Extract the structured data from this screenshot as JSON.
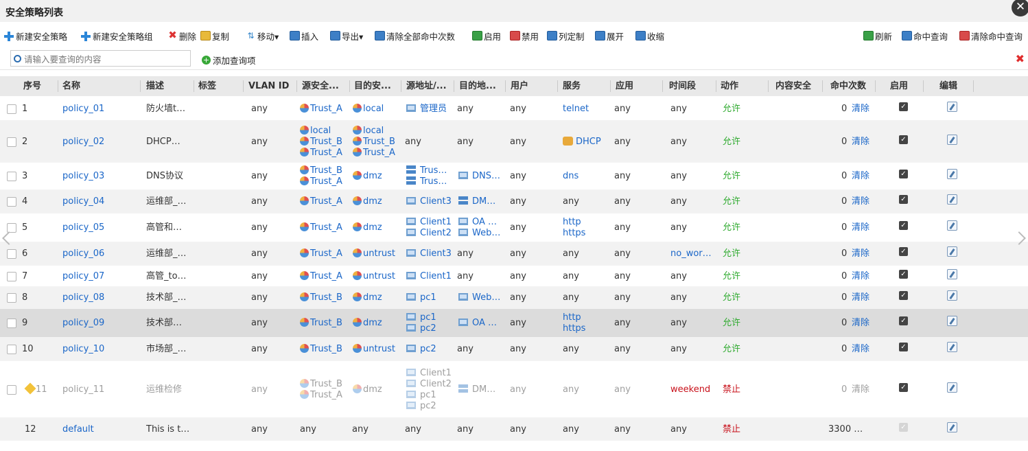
{
  "window": {
    "title": "安全策略列表",
    "close_glyph": "✕"
  },
  "toolbar": {
    "new_policy": "新建安全策略",
    "new_group": "新建安全策略组",
    "delete": "删除",
    "copy": "复制",
    "move": "移动▾",
    "insert": "插入",
    "export": "导出▾",
    "clear_hits": "清除全部命中次数",
    "enable": "启用",
    "disable": "禁用",
    "column_custom": "列定制",
    "expand": "展开",
    "collapse": "收缩",
    "refresh": "刷新",
    "hit_query": "命中查询",
    "clear_hit_query": "清除命中查询"
  },
  "search": {
    "placeholder": "请输入要查询的内容",
    "add_query": "添加查询项",
    "add_icon": "+"
  },
  "columns": {
    "seq": "序号",
    "name": "名称",
    "desc": "描述",
    "tag": "标签",
    "vlan": "VLAN ID",
    "src_zone": "源安全...",
    "dst_zone": "目的安...",
    "src_addr": "源地址/...",
    "dst_addr": "目的地...",
    "user": "用户",
    "service": "服务",
    "app": "应用",
    "time": "时间段",
    "action": "动作",
    "content": "内容安全",
    "hits": "命中次数",
    "enabled": "启用",
    "edit": "编辑"
  },
  "clear_label": "清除",
  "enabled_mark": "✓",
  "rows": [
    {
      "seq": "1",
      "name": "policy_01",
      "desc": "防火墙t…",
      "vlan": "any",
      "src_zone": [
        "Trust_A"
      ],
      "dst_zone": [
        "local"
      ],
      "src_addr": [
        "管理员"
      ],
      "dst_addr": [
        "any"
      ],
      "user": "any",
      "service": [
        "telnet"
      ],
      "app": "any",
      "time": "any",
      "action": "允许",
      "hits": "0"
    },
    {
      "seq": "2",
      "name": "policy_02",
      "desc": "DHCP…",
      "vlan": "any",
      "src_zone": [
        "local",
        "Trust_B",
        "Trust_A"
      ],
      "dst_zone": [
        "local",
        "Trust_B",
        "Trust_A"
      ],
      "src_addr": [
        "any"
      ],
      "dst_addr": [
        "any"
      ],
      "user": "any",
      "service": [
        "DHCP"
      ],
      "app": "any",
      "time": "any",
      "action": "允许",
      "hits": "0"
    },
    {
      "seq": "3",
      "name": "policy_03",
      "desc": "DNS协议",
      "vlan": "any",
      "src_zone": [
        "Trust_B",
        "Trust_A"
      ],
      "dst_zone": [
        "dmz"
      ],
      "src_addr": [
        "Trus…",
        "Trus…"
      ],
      "dst_addr": [
        "DNS…"
      ],
      "user": "any",
      "service": [
        "dns"
      ],
      "app": "any",
      "time": "any",
      "action": "允许",
      "hits": "0"
    },
    {
      "seq": "4",
      "name": "policy_04",
      "desc": "运维部_…",
      "vlan": "any",
      "src_zone": [
        "Trust_A"
      ],
      "dst_zone": [
        "dmz"
      ],
      "src_addr": [
        "Client3"
      ],
      "dst_addr": [
        "DM…"
      ],
      "user": "any",
      "service": [
        "any"
      ],
      "app": "any",
      "time": "any",
      "action": "允许",
      "hits": "0"
    },
    {
      "seq": "5",
      "name": "policy_05",
      "desc": "高管和…",
      "vlan": "any",
      "src_zone": [
        "Trust_A"
      ],
      "dst_zone": [
        "dmz"
      ],
      "src_addr": [
        "Client1",
        "Client2"
      ],
      "dst_addr": [
        "OA …",
        "Web…"
      ],
      "user": "any",
      "service": [
        "http",
        "https"
      ],
      "app": "any",
      "time": "any",
      "action": "允许",
      "hits": "0"
    },
    {
      "seq": "6",
      "name": "policy_06",
      "desc": "运维部_…",
      "vlan": "any",
      "src_zone": [
        "Trust_A"
      ],
      "dst_zone": [
        "untrust"
      ],
      "src_addr": [
        "Client3"
      ],
      "dst_addr": [
        "any"
      ],
      "user": "any",
      "service": [
        "any"
      ],
      "app": "any",
      "time": "no_wor…",
      "action": "允许",
      "hits": "0"
    },
    {
      "seq": "7",
      "name": "policy_07",
      "desc": "高管_to…",
      "vlan": "any",
      "src_zone": [
        "Trust_A"
      ],
      "dst_zone": [
        "untrust"
      ],
      "src_addr": [
        "Client1"
      ],
      "dst_addr": [
        "any"
      ],
      "user": "any",
      "service": [
        "any"
      ],
      "app": "any",
      "time": "any",
      "action": "允许",
      "hits": "0"
    },
    {
      "seq": "8",
      "name": "policy_08",
      "desc": "技术部_…",
      "vlan": "any",
      "src_zone": [
        "Trust_B"
      ],
      "dst_zone": [
        "dmz"
      ],
      "src_addr": [
        "pc1"
      ],
      "dst_addr": [
        "Web…"
      ],
      "user": "any",
      "service": [
        "any"
      ],
      "app": "any",
      "time": "any",
      "action": "允许",
      "hits": "0"
    },
    {
      "seq": "9",
      "name": "policy_09",
      "desc": "技术部…",
      "vlan": "any",
      "src_zone": [
        "Trust_B"
      ],
      "dst_zone": [
        "dmz"
      ],
      "src_addr": [
        "pc1",
        "pc2"
      ],
      "dst_addr": [
        "OA …"
      ],
      "user": "any",
      "service": [
        "http",
        "https"
      ],
      "app": "any",
      "time": "any",
      "action": "允许",
      "hits": "0"
    },
    {
      "seq": "10",
      "name": "policy_10",
      "desc": "市场部_…",
      "vlan": "any",
      "src_zone": [
        "Trust_B"
      ],
      "dst_zone": [
        "untrust"
      ],
      "src_addr": [
        "pc2"
      ],
      "dst_addr": [
        "any"
      ],
      "user": "any",
      "service": [
        "any"
      ],
      "app": "any",
      "time": "any",
      "action": "允许",
      "hits": "0"
    },
    {
      "seq": "11",
      "name": "policy_11",
      "desc": "运维检修",
      "vlan": "any",
      "src_zone": [
        "Trust_B",
        "Trust_A"
      ],
      "dst_zone": [
        "dmz"
      ],
      "src_addr": [
        "Client1",
        "Client2",
        "pc1",
        "pc2"
      ],
      "dst_addr": [
        "DM…"
      ],
      "user": "any",
      "service": [
        "any"
      ],
      "app": "any",
      "time": "weekend",
      "action": "禁止",
      "hits": "0"
    },
    {
      "seq": "12",
      "name": "default",
      "desc": "This is t…",
      "vlan": "any",
      "src_zone": [
        "any"
      ],
      "dst_zone": [
        "any"
      ],
      "src_addr": [
        "any"
      ],
      "dst_addr": [
        "any"
      ],
      "user": "any",
      "service": [
        "any"
      ],
      "app": "any",
      "time": "any",
      "action": "禁止",
      "hits": "3300 …"
    }
  ]
}
